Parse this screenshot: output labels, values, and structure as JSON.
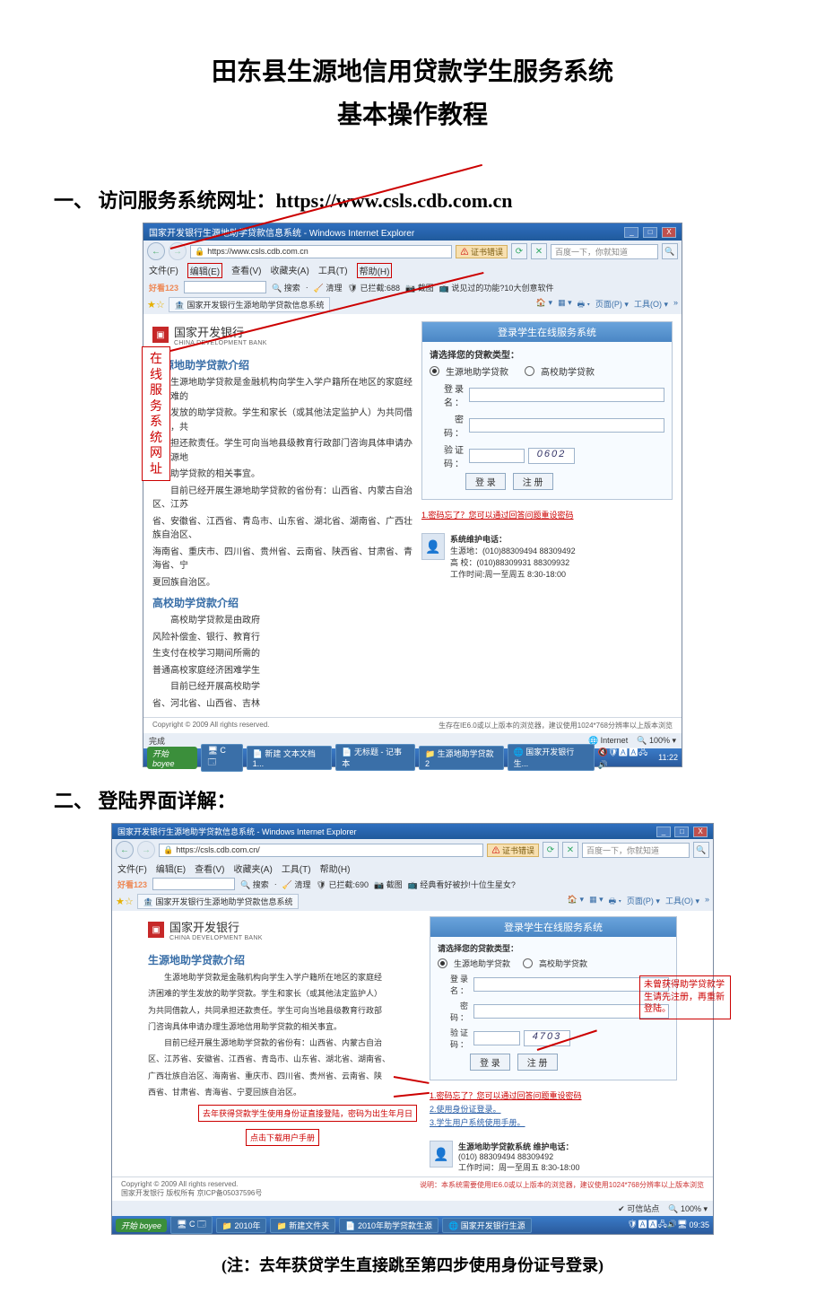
{
  "doc": {
    "title": "田东县生源地信用贷款学生服务系统",
    "subtitle": "基本操作教程",
    "section1": "一、 访问服务系统网址：",
    "section1_url": "https://www.csls.cdb.com.cn",
    "section2": "二、 登陆界面详解：",
    "note": "(注：去年获贷学生直接跳至第四步使用身份证号登录)"
  },
  "ss1": {
    "title": "国家开发银行生源地助学贷款信息系统 - Windows Internet Explorer",
    "url": "https://www.csls.cdb.com.cn",
    "cert_error": "证书错误",
    "search_placeholder": "百度一下，你就知道",
    "menu": {
      "file": "文件(F)",
      "edit": "编辑(E)",
      "view": "查看(V)",
      "fav": "收藏夹(A)",
      "tools": "工具(T)",
      "help": "帮助(H)"
    },
    "hao123": "好看123",
    "tool_search": "搜索",
    "tool_clean": "清理",
    "tool_block": "已拦截:688",
    "tool_screenshot": "截图",
    "tool_topic": "说见过的功能?10大创意软件",
    "tab_label": "国家开发银行生源地助学贷款信息系统",
    "ietool_page": "页面(P)",
    "ietool_tools": "工具(O)",
    "bank_cn": "国家开发银行",
    "bank_en": "CHINA DEVELOPMENT BANK",
    "intro_h": "生源地助学贷款介绍",
    "intro_p1": "生源地助学贷款是金融机构向学生入学户籍所在地区的家庭经济困难的",
    "intro_p2": "学生发放的助学贷款。学生和家长（或其他法定监护人）为共同借款人，共",
    "intro_p3": "同承担还款责任。学生可向当地县级教育行政部门咨询具体申请办理生源地",
    "intro_p4": "信用助学贷款的相关事宜。",
    "intro_p5": "目前已经开展生源地助学贷款的省份有：山西省、内蒙古自治区、江苏",
    "intro_p6": "省、安徽省、江西省、青岛市、山东省、湖北省、湖南省、广西壮族自治区、",
    "intro_p7": "海南省、重庆市、四川省、贵州省、云南省、陕西省、甘肃省、青海省、宁",
    "intro_p8": "夏回族自治区。",
    "gx_h": "高校助学贷款介绍",
    "gx_p1": "高校助学贷款是由政府",
    "gx_p2": "风险补偿金、银行、教育行",
    "gx_p3": "生支付在校学习期间所需的",
    "gx_p4": "普通高校家庭经济困难学生",
    "gx_p5": "目前已经开展高校助学",
    "gx_p6": "省、河北省、山西省、吉林",
    "login_hdr": "登录学生在线服务系统",
    "login_type_label": "请选择您的贷款类型：",
    "login_type1": "生源地助学贷款",
    "login_type2": "高校助学贷款",
    "login_user": "登录名：",
    "login_pass": "密  码：",
    "login_captcha_lbl": "验证码：",
    "login_captcha_val": "0602",
    "btn_login": "登  录",
    "btn_register": "注  册",
    "forgot": "1.密码忘了？您可以通过回答问题重设密码",
    "support_h": "系统维护电话：",
    "support_l1": "生源地：(010)88309494 88309492",
    "support_l2": "高  校：(010)88309931 88309932",
    "support_l3": "工作时间:周一至周五  8:30-18:00",
    "footer_l": "Copyright © 2009 All rights reserved.",
    "footer_r": "生存在IE6.0或以上版本的浏览器，建议使用1024*768分辨率以上版本浏览",
    "status_done": "完成",
    "status_net": "Internet",
    "status_zoom": "100%",
    "task_start": "开始",
    "task1": "新建 文本文档1...",
    "task2": "无标题 - 记事本",
    "task3": "生源地助学贷款2",
    "task4": "国家开发银行生...",
    "tray_time": "11:22",
    "callout": "在线服务系统网址"
  },
  "ss2": {
    "title": "国家开发银行生源地助学贷款信息系统 - Windows Internet Explorer",
    "url": "https://csls.cdb.com.cn/",
    "cert_error": "证书错误",
    "search_placeholder": "百度一下，你就知道",
    "menu": {
      "file": "文件(F)",
      "edit": "编辑(E)",
      "view": "查看(V)",
      "fav": "收藏夹(A)",
      "tools": "工具(T)",
      "help": "帮助(H)"
    },
    "hao123": "好看123",
    "tool_search": "搜索",
    "tool_clean": "清理",
    "tool_block": "已拦截:690",
    "tool_screenshot": "截图",
    "tool_topic": "经典看好被抄!十位生星女?",
    "tab_label": "国家开发银行生源地助学贷款信息系统",
    "ietool_page": "页面(P)",
    "ietool_tools": "工具(O)",
    "bank_cn": "国家开发银行",
    "bank_en": "CHINA DEVELOPMENT BANK",
    "intro_h": "生源地助学贷款介绍",
    "intro_p1": "生源地助学贷款是金融机构向学生入学户籍所在地区的家庭经",
    "intro_p2": "济困难的学生发放的助学贷款。学生和家长（或其他法定监护人）",
    "intro_p3": "为共同借款人，共同承担还款责任。学生可向当地县级教育行政部",
    "intro_p4": "门咨询具体申请办理生源地信用助学贷款的相关事宜。",
    "intro_p5": "目前已经开展生源地助学贷款的省份有：山西省、内蒙古自治",
    "intro_p6": "区、江苏省、安徽省、江西省、青岛市、山东省、湖北省、湖南省、",
    "intro_p7": "广西壮族自治区、海南省、重庆市、四川省、贵州省、云南省、陕",
    "intro_p8": "西省、甘肃省、青海省、宁夏回族自治区。",
    "callout_left1": "去年获得贷款学生使用身份证直接登陆，密码为出生年月日",
    "callout_left2": "点击下载用户手册",
    "login_hdr": "登录学生在线服务系统",
    "login_type_label": "请选择您的贷款类型：",
    "login_type1": "生源地助学贷款",
    "login_type2": "高校助学贷款",
    "login_user": "登录名：",
    "login_pass": "密  码：",
    "login_captcha_lbl": "验证码：",
    "login_captcha_val": "4703",
    "btn_login": "登  录",
    "btn_register": "注  册",
    "link1": "1.密码忘了？您可以通过回答问题重设密码",
    "link2": "2.使用身份证登录。",
    "link3": "3.学生用户系统使用手册。",
    "callout_right": "未曾获得助学贷款学生请先注册，再重新登陆。",
    "support_h": "生源地助学贷款系统 维护电话：",
    "support_l1": "(010) 88309494 88309492",
    "support_l2": "工作时间：周一至周五  8:30-18:00",
    "footer_l": "Copyright © 2009 All rights reserved.",
    "footer_l2": "国家开发银行 版权所有  京ICP备05037596号",
    "footer_r": "说明：本系统需要使用IE6.0或以上版本的浏览器，建议使用1024*768分辨率以上版本浏览",
    "status_trust": "可信站点",
    "status_zoom": "100%",
    "task_start": "开始",
    "task_year": "2010年",
    "task1": "新建文件夹",
    "task2": "2010年助学贷款生源",
    "task3": "国家开发银行生源",
    "tray_time": "09:35"
  }
}
